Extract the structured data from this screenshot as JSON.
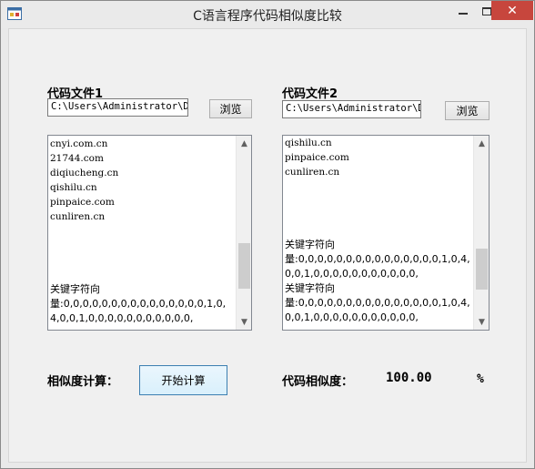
{
  "window": {
    "title": "C语言程序代码相似度比较",
    "close_glyph": "✕"
  },
  "file1": {
    "label": "代码文件1",
    "path": "C:\\Users\\Administrator\\De",
    "browse_label": "浏览",
    "lines": [
      "cnyi.com.cn",
      "21744.com",
      "diqiucheng.cn",
      "qishilu.cn",
      "pinpaice.com",
      "cunliren.cn",
      "",
      "",
      "",
      "",
      "关键字符向",
      "量:0,0,0,0,0,0,0,0,0,0,0,0,0,0,0,1,0,4,0,0,1,0,0,0,0,0,0,0,0,0,0,0,"
    ]
  },
  "file2": {
    "label": "代码文件2",
    "path": "C:\\Users\\Administrator\\De",
    "browse_label": "浏览",
    "lines": [
      "qishilu.cn",
      "pinpaice.com",
      "cunliren.cn",
      "",
      "",
      "",
      "",
      "关键字符向",
      "量:0,0,0,0,0,0,0,0,0,0,0,0,0,0,0,1,0,4,0,0,1,0,0,0,0,0,0,0,0,0,0,0,",
      "关键字符向",
      "量:0,0,0,0,0,0,0,0,0,0,0,0,0,0,0,1,0,4,0,0,1,0,0,0,0,0,0,0,0,0,0,0,"
    ]
  },
  "actions": {
    "calc_label": "相似度计算：",
    "start_button": "开始计算"
  },
  "result": {
    "label": "代码相似度：",
    "value": "100.00",
    "unit": "%"
  },
  "scrollbars": {
    "file1_thumb_position": 0.78,
    "file2_thumb_position": 0.8
  }
}
